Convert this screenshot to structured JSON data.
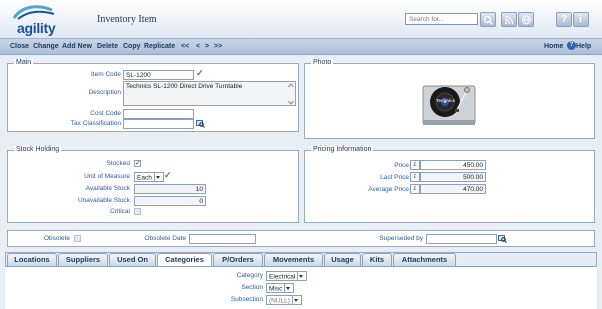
{
  "app": {
    "logo_text": "agility",
    "title": "Inventory Item"
  },
  "search": {
    "placeholder": "Search for..."
  },
  "toolbar": {
    "items": [
      "Close",
      "Change",
      "Add New",
      "Delete",
      "Copy",
      "Replicate",
      "<<",
      "<",
      ">",
      ">>"
    ],
    "home": "Home",
    "help": "Help"
  },
  "main": {
    "legend": "Main",
    "item_code_label": "Item Code",
    "item_code": "SL-1200",
    "description_label": "Description",
    "description": "Technics SL-1200 Direct Drive Turntable",
    "cost_code_label": "Cost Code",
    "cost_code": "",
    "tax_label": "Tax Classification",
    "tax": ""
  },
  "photo": {
    "legend": "Photo",
    "brand_text": "Technics"
  },
  "stock": {
    "legend": "Stock Holding",
    "stocked_label": "Stocked",
    "stocked": true,
    "uom_label": "Unit of Measure",
    "uom": "Each",
    "available_label": "Available Stock",
    "available": "10",
    "unavailable_label": "Unavailable Stock",
    "unavailable": "0",
    "critical_label": "Critical",
    "critical": false
  },
  "pricing": {
    "legend": "Pricing Information",
    "currency_symbol": "£",
    "price_label": "Price",
    "price": "450.00",
    "last_price_label": "Last Price",
    "last_price": "500.00",
    "average_price_label": "Average Price",
    "average_price": "470.00"
  },
  "obsolete": {
    "obsolete_label": "Obsolete",
    "obsolete_date_label": "Obsolete Date",
    "obsolete_date": "",
    "superseded_label": "Superseded by",
    "superseded": ""
  },
  "tabs": [
    "Locations",
    "Suppliers",
    "Used On",
    "Categories",
    "P/Orders",
    "Movements",
    "Usage",
    "Kits",
    "Attachments"
  ],
  "active_tab": "Categories",
  "categories": {
    "category_label": "Category",
    "category": "Electrical",
    "section_label": "Section",
    "section": "Misc",
    "subsection_label": "Subsection",
    "subsection": "(NULL)"
  },
  "colors": {
    "accent": "#1b4f9c",
    "label": "#2d5c9c",
    "ok": "#2d9a2d"
  }
}
